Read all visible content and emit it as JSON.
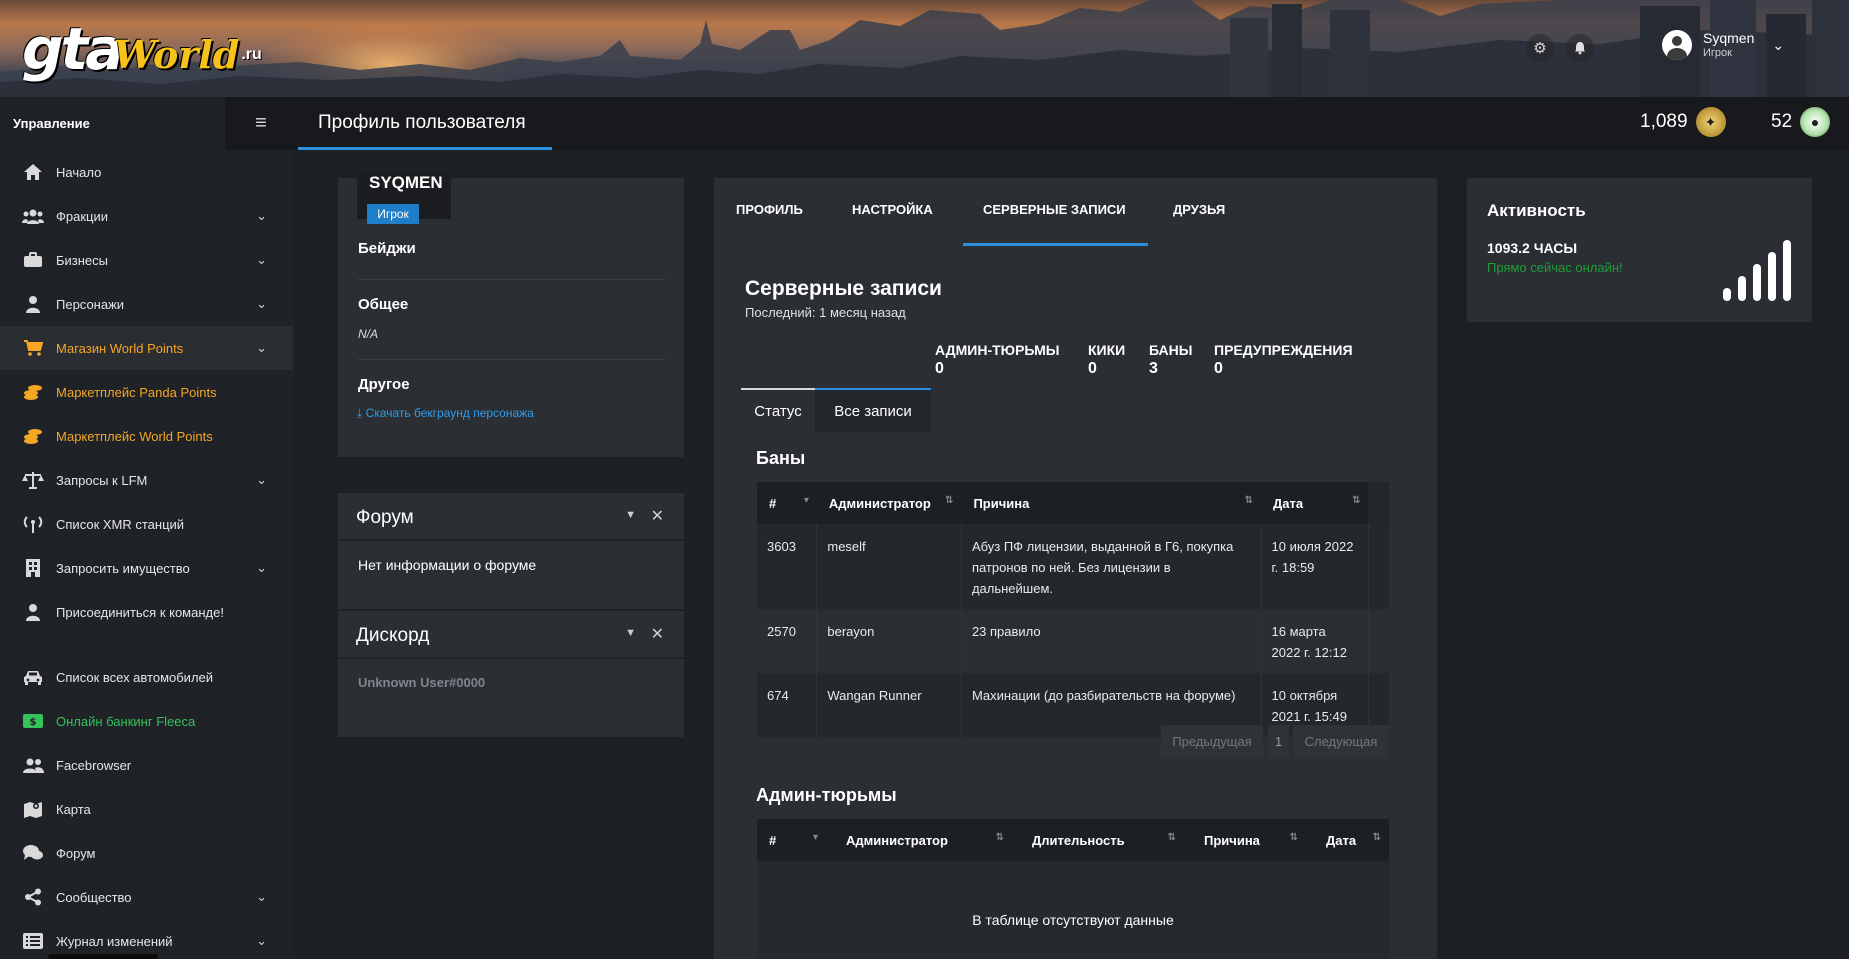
{
  "header": {
    "logo": {
      "text_a": "gta",
      "text_b": "World",
      "text_c": ".ru"
    },
    "user": {
      "name": "Syqmen",
      "role": "Игрок"
    },
    "icons": [
      "gear-icon",
      "bell-icon",
      "user-avatar",
      "chevron-down-icon"
    ]
  },
  "topbar": {
    "sidebar_title": "Управление",
    "page_title": "Профиль пользователя",
    "world_points": "1,089",
    "panda_points": "52"
  },
  "sidebar": {
    "items": [
      {
        "label": "Начало",
        "icon": "home-icon",
        "chevron": false
      },
      {
        "label": "Фракции",
        "icon": "users-icon",
        "chevron": true
      },
      {
        "label": "Бизнесы",
        "icon": "briefcase-icon",
        "chevron": true
      },
      {
        "label": "Персонажи",
        "icon": "person-icon",
        "chevron": true
      },
      {
        "label": "Магазин World Points",
        "icon": "cart-icon",
        "chevron": true,
        "color": "#f5a623"
      },
      {
        "label": "Маркетплейс Panda Points",
        "icon": "coins-icon",
        "chevron": false,
        "color": "#f5a623"
      },
      {
        "label": "Маркетплейс World Points",
        "icon": "coins-icon",
        "chevron": false,
        "color": "#f5a623"
      },
      {
        "label": "Запросы к LFM",
        "icon": "scale-icon",
        "chevron": true
      },
      {
        "label": "Список XMR станций",
        "icon": "antenna-icon",
        "chevron": false
      },
      {
        "label": "Запросить имущество",
        "icon": "building-icon",
        "chevron": true
      },
      {
        "label": "Присоединиться к команде!",
        "icon": "person-icon",
        "chevron": false
      },
      {
        "label": "Список всех автомобилей",
        "icon": "car-icon",
        "chevron": false
      },
      {
        "label": "Онлайн банкинг Fleeca",
        "icon": "money-icon",
        "chevron": false,
        "color": "#36c25a"
      },
      {
        "label": "Facebrowser",
        "icon": "users-icon",
        "chevron": false
      },
      {
        "label": "Карта",
        "icon": "map-icon",
        "chevron": false
      },
      {
        "label": "Форум",
        "icon": "comments-icon",
        "chevron": false
      },
      {
        "label": "Сообщество",
        "icon": "share-icon",
        "chevron": true
      },
      {
        "label": "Журнал изменений",
        "icon": "list-icon",
        "chevron": true
      }
    ]
  },
  "profile": {
    "name": "SYQMEN",
    "role": "Игрок",
    "badges_label": "Бейджи",
    "general_label": "Общее",
    "general_value": "N/A",
    "other_label": "Другое",
    "download_link": "Скачать бекграунд персонажа"
  },
  "forum_widget": {
    "title": "Форум",
    "body": "Нет информации о форуме"
  },
  "discord_widget": {
    "title": "Дискорд",
    "body": "Unknown User#0000"
  },
  "tabs": [
    "ПРОФИЛЬ",
    "НАСТРОЙКА",
    "СЕРВЕРНЫЕ ЗАПИСИ",
    "ДРУЗЬЯ"
  ],
  "records": {
    "title": "Серверные записи",
    "last": "Последний: 1 месяц назад",
    "stats": [
      {
        "label": "АДМИН-ТЮРЬМЫ",
        "value": "0"
      },
      {
        "label": "КИКИ",
        "value": "0"
      },
      {
        "label": "БАНЫ",
        "value": "3"
      },
      {
        "label": "ПРЕДУПРЕЖДЕНИЯ",
        "value": "0"
      }
    ],
    "subtabs": [
      "Статус",
      "Все записи"
    ],
    "bans": {
      "title": "Баны",
      "columns": [
        "#",
        "Администратор",
        "Причина",
        "Дата"
      ],
      "rows": [
        {
          "id": "3603",
          "admin": "meself",
          "reason": "Абуз ПФ лицензии, выданной в Г6, покупка патронов по ней. Без лицензии в дальнейшем.",
          "date": "10 июля 2022 г. 18:59"
        },
        {
          "id": "2570",
          "admin": "berayon",
          "reason": "23 правило",
          "date": "16 марта 2022 г. 12:12"
        },
        {
          "id": "674",
          "admin": "Wangan Runner",
          "reason": "Махинации (до разбирательств на форуме)",
          "date": "10 октября 2021 г. 15:49"
        }
      ],
      "pager": {
        "prev": "Предыдущая",
        "page": "1",
        "next": "Следующая"
      }
    },
    "jails": {
      "title": "Админ-тюрьмы",
      "columns": [
        "#",
        "Администратор",
        "Длительность",
        "Причина",
        "Дата"
      ],
      "empty": "В таблице отсутствуют данные"
    }
  },
  "activity": {
    "title": "Активность",
    "hours": "1093.2 ЧАСЫ",
    "online": "Прямо сейчас онлайн!",
    "signal_level": 1.0
  }
}
